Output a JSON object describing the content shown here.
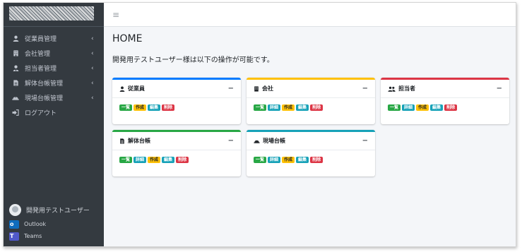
{
  "sidebar": {
    "items": [
      {
        "label": "従業員管理",
        "icon": "user-icon"
      },
      {
        "label": "会社管理",
        "icon": "building-icon"
      },
      {
        "label": "担当者管理",
        "icon": "user-tie-icon"
      },
      {
        "label": "解体台帳管理",
        "icon": "file-icon"
      },
      {
        "label": "現場台帳管理",
        "icon": "hardhat-icon"
      }
    ],
    "logout_label": "ログアウト",
    "chevron": "‹",
    "user_name": "開発用テストユーザー",
    "links": {
      "outlook": "Outlook",
      "teams": "Teams"
    }
  },
  "topbar": {
    "menu_icon": "≡"
  },
  "main": {
    "title": "HOME",
    "intro": "開発用テストユーザー様は以下の操作が可能です。",
    "collapse_symbol": "−"
  },
  "cards": [
    {
      "title": "従業員",
      "accent": "#007bff",
      "icon": "user-icon",
      "badges": [
        "一覧",
        "作成",
        "編集",
        "削除"
      ]
    },
    {
      "title": "会社",
      "accent": "#ffc107",
      "icon": "building-icon",
      "badges": [
        "一覧",
        "詳細",
        "作成",
        "編集",
        "削除"
      ]
    },
    {
      "title": "担当者",
      "accent": "#dc3545",
      "icon": "users-icon",
      "badges": [
        "一覧",
        "詳細",
        "作成",
        "編集",
        "削除"
      ]
    },
    {
      "title": "解体台帳",
      "accent": "#28a745",
      "icon": "file-icon",
      "badges": [
        "一覧",
        "詳細",
        "作成",
        "編集",
        "削除"
      ]
    },
    {
      "title": "現場台帳",
      "accent": "#17a2b8",
      "icon": "hardhat-icon",
      "badges": [
        "一覧",
        "詳細",
        "作成",
        "編集",
        "削除"
      ]
    }
  ]
}
